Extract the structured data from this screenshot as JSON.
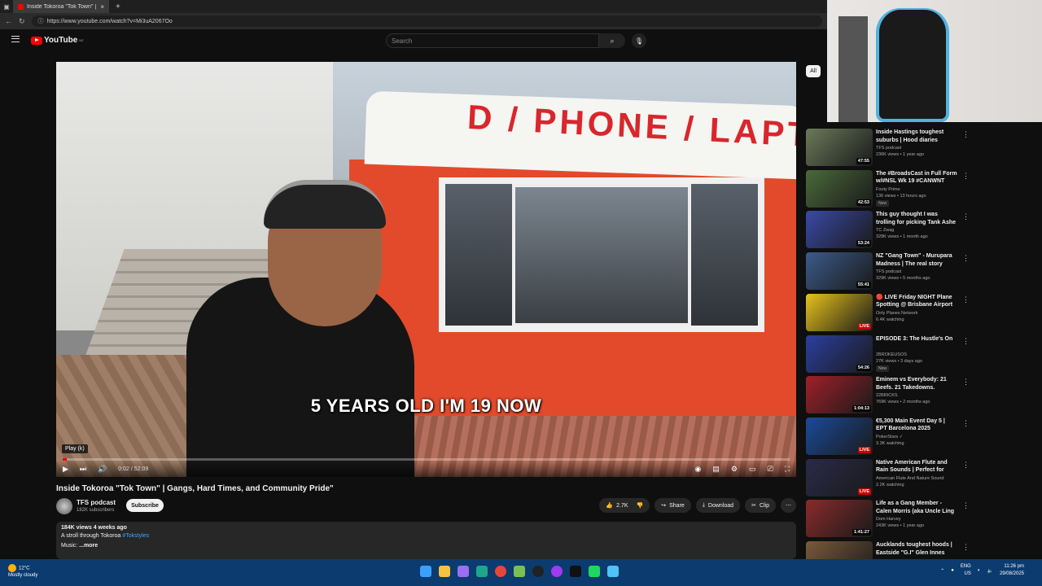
{
  "browser": {
    "tab_title": "Inside Tokoroa \"Tok Town\" | Gang",
    "url": "https://www.youtube.com/watch?v=Mi3uA2067Oo"
  },
  "yt": {
    "logo": "YouTube",
    "region": "NZ",
    "search_placeholder": "Search"
  },
  "player": {
    "overlay_sign": "D / PHONE / LAPT",
    "subtitle": "5 YEARS OLD I'M 19 NOW",
    "tooltip": "Play (k)",
    "time": "0:02 / 52:09",
    "progress_fraction": 0.0006
  },
  "video": {
    "title": "Inside Tokoroa \"Tok Town\" | Gangs, Hard Times, and Community Pride\"",
    "channel": "TFS podcast",
    "subscribers": "182K subscribers",
    "subscribe": "Subscribe",
    "likes": "2.7K",
    "share": "Share",
    "download": "Download",
    "clip": "Clip",
    "desc_meta": "184K views  4 weeks ago",
    "desc_line": "A stroll through Tokoroa ",
    "desc_tag": "#Tokstyles",
    "desc_more_prefix": "Music: ",
    "desc_more": "...more"
  },
  "sidebar": {
    "chip_all": "All",
    "items": [
      {
        "title": "Inside Hastings toughest suburbs | Hood diaries",
        "channel": "TFS podcast",
        "meta": "236K views • 1 year ago",
        "badge": "",
        "duration": "47:55",
        "live": false,
        "color": "#6b7a5a"
      },
      {
        "title": "The #BroadsCast in Full Form w/#NSL Wk 19 #CANWNT",
        "channel": "Footy Prime",
        "meta": "136 views • 13 hours ago",
        "badge": "New",
        "duration": "42:53",
        "live": false,
        "color": "#4a6a3a"
      },
      {
        "title": "This guy thought I was trolling for picking Tank Ashe Top... b...",
        "channel": "TC Zwag",
        "meta": "328K views • 1 month ago",
        "badge": "",
        "duration": "53:24",
        "live": false,
        "color": "#3a4aa8"
      },
      {
        "title": "NZ \"Gang Town\" - Murupara Madness | The real story",
        "channel": "TFS podcast",
        "meta": "329K views • 5 months ago",
        "badge": "",
        "duration": "55:41",
        "live": false,
        "color": "#3b5b8a"
      },
      {
        "title": "🔴 LIVE Friday NIGHT Plane Spotting @ Brisbane Airport ...",
        "channel": "Only Planes Network",
        "meta": "6.4K watching",
        "badge": "",
        "duration": "LIVE",
        "live": true,
        "color": "#e8c21a"
      },
      {
        "title": "EPISODE 3: The Hustle's On",
        "channel": "2BROKEUSOS",
        "meta": "27K views • 3 days ago",
        "badge": "New",
        "duration": "54:26",
        "live": false,
        "color": "#2b3fa0"
      },
      {
        "title": "Eminem vs Everybody: 21 Beefs. 21 Takedowns.",
        "channel": "22BRICKS",
        "meta": "769K views • 2 months ago",
        "badge": "",
        "duration": "1:04:13",
        "live": false,
        "color": "#a0202a"
      },
      {
        "title": "€5,300 Main Event Day 5 | EPT Barcelona 2025",
        "channel": "PokerStars ✓",
        "meta": "3.3K watching",
        "badge": "",
        "duration": "LIVE",
        "live": true,
        "color": "#1a4a9a"
      },
      {
        "title": "Native American Flute and Rain Sounds | Perfect for Relaxatio...",
        "channel": "American Flute And Nature Sound",
        "meta": "2.2K watching",
        "badge": "",
        "duration": "LIVE",
        "live": true,
        "color": "#2a2a4a"
      },
      {
        "title": "Life as a Gang Member - Calen Morris (aka Uncle Ling Ling) o...",
        "channel": "Dom Harvey",
        "meta": "243K views • 1 year ago",
        "badge": "",
        "duration": "1:41:27",
        "live": false,
        "color": "#8a2a2a"
      },
      {
        "title": "Aucklands toughest hoods | Eastside \"G.I\" Glen Innes",
        "channel": "",
        "meta": "",
        "badge": "",
        "duration": "",
        "live": false,
        "color": "#7a5a3a"
      }
    ]
  },
  "taskbar": {
    "temp": "12°C",
    "weather": "Mostly cloudy",
    "lang1": "ENG",
    "lang2": "US",
    "time": "11:26 pm",
    "date": "29/08/2025"
  }
}
